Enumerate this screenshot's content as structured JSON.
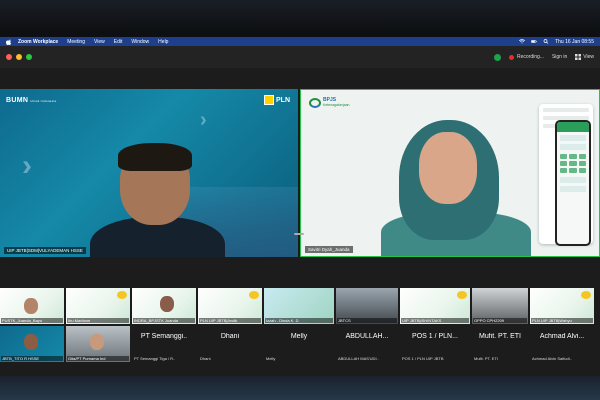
{
  "menubar": {
    "app": "Zoom Workplace",
    "items": [
      "Meeting",
      "View",
      "Edit",
      "Window",
      "Help"
    ],
    "clock": "Thu 16 Jan 08:55"
  },
  "titlebar": {
    "recording": "Recording...",
    "sign_in": "Sign in",
    "view": "View"
  },
  "tiles": {
    "left": {
      "name": "UIP JBTB|SDM|VULYADEMAN HSSE",
      "brand_left": "BUMN",
      "brand_right": "PLN"
    },
    "right": {
      "name": "Savitri Dyah_Juanda ",
      "logo": "BPJS",
      "logo_sub": "Ketenagakerjaan"
    }
  },
  "gallery_row1": [
    {
      "label": "PUSTK_Juanda_Bayu"
    },
    {
      "label": "Ibu Martiane"
    },
    {
      "label": "INDRA_BPJSTK Juanda"
    },
    {
      "label": "PLN UIP JBTB|Andik"
    },
    {
      "label": "Izzah - Dinda K. D"
    },
    {
      "label": "JBTCS"
    },
    {
      "label": "UIP JBTB|ISHINTAKS"
    },
    {
      "label": "OPPO CPH2209"
    },
    {
      "label": "PLN UIP JBTB|Wahyu"
    }
  ],
  "gallery_row2": [
    {
      "label": "JBTB_TITO R HSSE",
      "type": "video"
    },
    {
      "label": "Gita/PT Purnama Ind",
      "type": "video"
    },
    {
      "title": "PT Semanggi..",
      "label": "PT Semanggi Tiga / R..",
      "type": "named"
    },
    {
      "title": "Dhani",
      "label": "Dhani",
      "type": "named"
    },
    {
      "title": "Melly",
      "label": "Melly",
      "type": "named"
    },
    {
      "title": "ABDULLAH...",
      "label": "ABDULLAH MAS'UDI..",
      "type": "named"
    },
    {
      "title": "POS 1 / PLN...",
      "label": "POS 1 / PLN UIP JBTB",
      "type": "named"
    },
    {
      "title": "Mufit. PT. ETI",
      "label": "Mufit. PT. ETI",
      "type": "named"
    },
    {
      "title": "Achmad Alvi...",
      "label": "Achmad Alvin Saifudi..",
      "type": "named"
    }
  ],
  "colors": {
    "menubar": "#1e3f8c",
    "active_speaker": "#27c24a",
    "recording": "#e0312c",
    "bpjs_green": "#1e8e3e",
    "pln_yellow": "#ffd200"
  },
  "icons": [
    "apple-icon",
    "wifi-icon",
    "battery-icon",
    "search-icon",
    "shield-icon",
    "record-icon",
    "grid-view-icon",
    "chevron-right-icon"
  ]
}
